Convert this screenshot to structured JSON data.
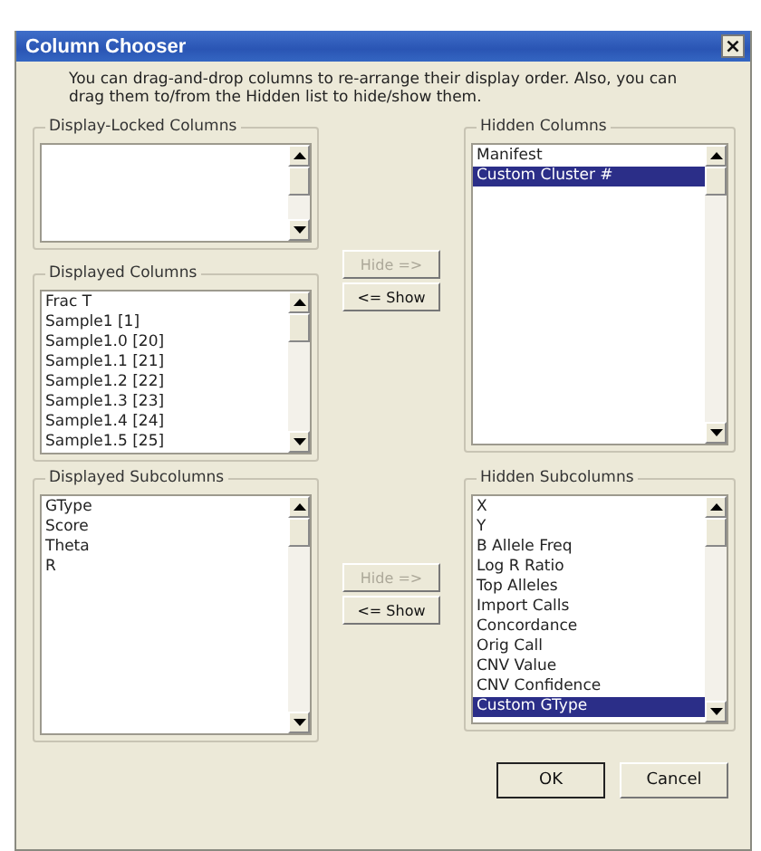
{
  "window": {
    "title": "Column Chooser",
    "close": "×"
  },
  "instructions": "You can drag-and-drop columns to re-arrange their display order.  Also, you can drag them to/from the Hidden list to hide/show them.",
  "locked_columns": {
    "title": "Display-Locked Columns"
  },
  "hidden_columns": {
    "title": "Hidden Columns",
    "items": [
      {
        "label": "Manifest",
        "selected": false
      },
      {
        "label": "Custom Cluster #",
        "selected": true
      }
    ]
  },
  "displayed_columns": {
    "title": "Displayed Columns",
    "items": [
      {
        "label": "Frac T",
        "selected": false
      },
      {
        "label": "Sample1 [1]",
        "selected": false
      },
      {
        "label": "Sample1.0 [20]",
        "selected": false
      },
      {
        "label": "Sample1.1 [21]",
        "selected": false
      },
      {
        "label": "Sample1.2 [22]",
        "selected": false
      },
      {
        "label": "Sample1.3 [23]",
        "selected": false
      },
      {
        "label": "Sample1.4 [24]",
        "selected": false
      },
      {
        "label": "Sample1.5 [25]",
        "selected": false
      }
    ]
  },
  "move_buttons": [
    {
      "hide": {
        "label": "Hide =>",
        "disabled": true
      },
      "show": {
        "label": "<= Show",
        "disabled": false
      }
    },
    {
      "hide": {
        "label": "Hide =>",
        "disabled": true
      },
      "show": {
        "label": "<= Show",
        "disabled": false
      }
    }
  ],
  "displayed_subcolumns": {
    "title": "Displayed Subcolumns",
    "items": [
      {
        "label": "GType",
        "selected": false
      },
      {
        "label": "Score",
        "selected": false
      },
      {
        "label": "Theta",
        "selected": false
      },
      {
        "label": "R",
        "selected": false
      }
    ]
  },
  "hidden_subcolumns": {
    "title": "Hidden Subcolumns",
    "items": [
      {
        "label": "X",
        "selected": false
      },
      {
        "label": "Y",
        "selected": false
      },
      {
        "label": "B Allele Freq",
        "selected": false
      },
      {
        "label": "Log R Ratio",
        "selected": false
      },
      {
        "label": "Top Alleles",
        "selected": false
      },
      {
        "label": "Import Calls",
        "selected": false
      },
      {
        "label": "Concordance",
        "selected": false
      },
      {
        "label": "Orig Call",
        "selected": false
      },
      {
        "label": "CNV Value",
        "selected": false
      },
      {
        "label": "CNV Confidence",
        "selected": false
      },
      {
        "label": "Custom GType",
        "selected": true
      }
    ]
  },
  "buttons": [
    {
      "label": "OK",
      "default": true
    },
    {
      "label": "Cancel",
      "default": false
    }
  ]
}
